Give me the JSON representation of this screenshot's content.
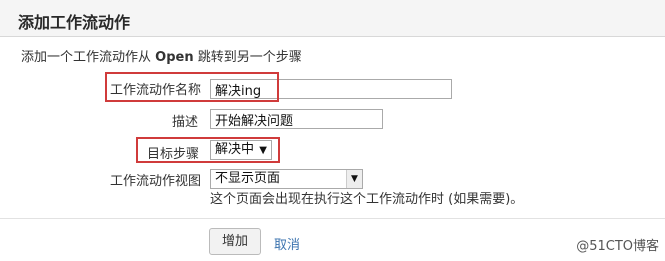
{
  "header": {
    "title": "添加工作流动作"
  },
  "description": {
    "prefix": "添加一个工作流动作从 ",
    "status": "Open",
    "suffix": " 跳转到另一个步骤"
  },
  "form": {
    "name": {
      "label": "工作流动作名称",
      "value": "解决ing"
    },
    "description": {
      "label": "描述",
      "value": "开始解决问题"
    },
    "target_step": {
      "label": "目标步骤",
      "value": "解决中",
      "arrow": "▼"
    },
    "view": {
      "label": "工作流动作视图",
      "value": "不显示页面",
      "arrow": "▼",
      "help": "这个页面会出现在执行这个工作流动作时 (如果需要)。"
    }
  },
  "buttons": {
    "add": "增加",
    "cancel": "取消"
  },
  "watermark": "@51CTO博客",
  "colors": {
    "highlight": "#d03b3b",
    "link": "#3b73af"
  }
}
